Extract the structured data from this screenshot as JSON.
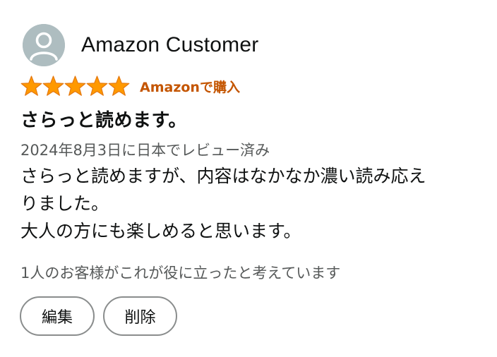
{
  "profile": {
    "avatar_icon": "user-silhouette-icon",
    "name": "Amazon Customer"
  },
  "rating": {
    "stars": 5,
    "max_stars": 5,
    "star_color": "#ff9900",
    "verified_label": "Amazonで購入",
    "verified_color": "#c45500"
  },
  "review": {
    "title": "さらっと読めます。",
    "date_line": "2024年8月3日に日本でレビュー済み",
    "body_lines": [
      "さらっと読めますが、内容はなかなか濃い読み応え",
      "りました。",
      "大人の方にも楽しめると思います。"
    ]
  },
  "helpful": {
    "text": "1人のお客様がこれが役に立ったと考えています"
  },
  "actions": {
    "edit_label": "編集",
    "delete_label": "削除"
  }
}
